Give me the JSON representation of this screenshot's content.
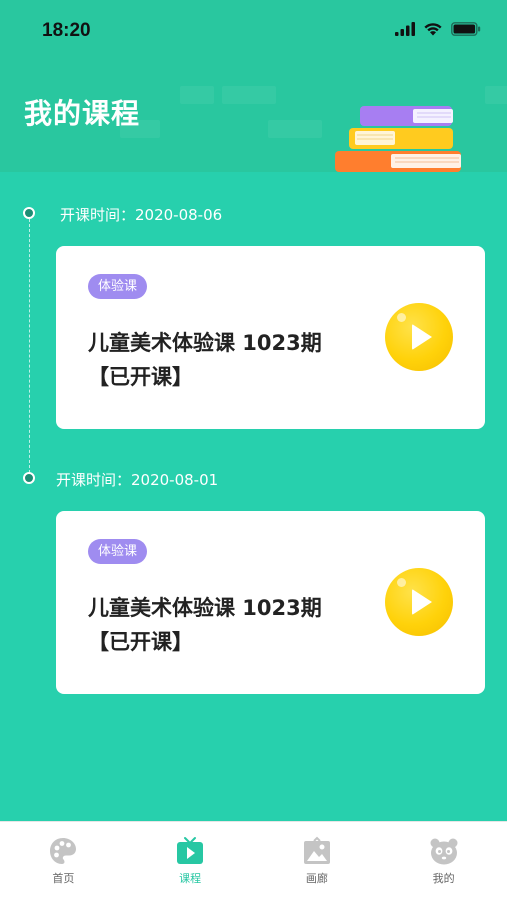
{
  "status_bar": {
    "time": "18:20"
  },
  "header": {
    "title": "我的课程",
    "illustration": "book-stack-icon"
  },
  "colors": {
    "background": "#27d0ad",
    "header": "#29c79f",
    "badge": "#9f8cf0",
    "play_button": "#ffd20a",
    "active_tab": "#27c7a3"
  },
  "courses": [
    {
      "date_label": "开课时间：2020-08-06",
      "badge": "体验课",
      "title_line1": "儿童美术体验课 1023期",
      "title_line2": "【已开课】"
    },
    {
      "date_label": "开课时间：2020-08-01",
      "badge": "体验课",
      "title_line1": "儿童美术体验课 1023期",
      "title_line2": "【已开课】"
    }
  ],
  "tabbar": {
    "items": [
      {
        "label": "首页",
        "icon": "palette-icon",
        "active": false
      },
      {
        "label": "课程",
        "icon": "tv-play-icon",
        "active": true
      },
      {
        "label": "画廊",
        "icon": "picture-icon",
        "active": false
      },
      {
        "label": "我的",
        "icon": "panda-icon",
        "active": false
      }
    ]
  }
}
